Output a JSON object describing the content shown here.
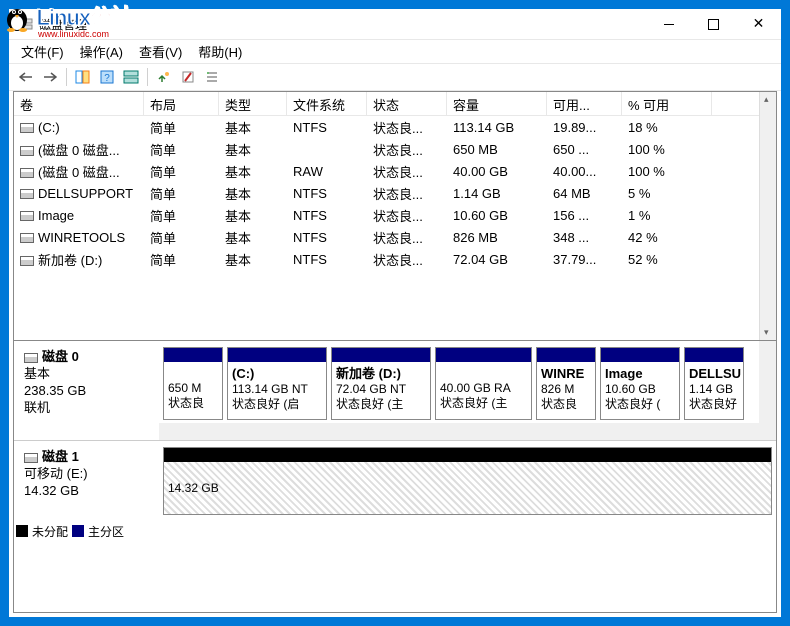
{
  "watermark": {
    "brand1": "Linux",
    "brand2": "公社",
    "url": "www.linuxidc.com"
  },
  "window": {
    "title": "磁盘管理"
  },
  "menubar": [
    "文件(F)",
    "操作(A)",
    "查看(V)",
    "帮助(H)"
  ],
  "columns": {
    "volume": "卷",
    "layout": "布局",
    "type": "类型",
    "fs": "文件系统",
    "status": "状态",
    "capacity": "容量",
    "free": "可用...",
    "pct": "% 可用"
  },
  "volumes": [
    {
      "name": "(C:)",
      "layout": "简单",
      "type": "基本",
      "fs": "NTFS",
      "status": "状态良...",
      "cap": "113.14 GB",
      "free": "19.89...",
      "pct": "18 %"
    },
    {
      "name": "(磁盘 0 磁盘...",
      "layout": "简单",
      "type": "基本",
      "fs": "",
      "status": "状态良...",
      "cap": "650 MB",
      "free": "650 ...",
      "pct": "100 %"
    },
    {
      "name": "(磁盘 0 磁盘...",
      "layout": "简单",
      "type": "基本",
      "fs": "RAW",
      "status": "状态良...",
      "cap": "40.00 GB",
      "free": "40.00...",
      "pct": "100 %"
    },
    {
      "name": "DELLSUPPORT",
      "layout": "简单",
      "type": "基本",
      "fs": "NTFS",
      "status": "状态良...",
      "cap": "1.14 GB",
      "free": "64 MB",
      "pct": "5 %"
    },
    {
      "name": "Image",
      "layout": "简单",
      "type": "基本",
      "fs": "NTFS",
      "status": "状态良...",
      "cap": "10.60 GB",
      "free": "156 ...",
      "pct": "1 %"
    },
    {
      "name": "WINRETOOLS",
      "layout": "简单",
      "type": "基本",
      "fs": "NTFS",
      "status": "状态良...",
      "cap": "826 MB",
      "free": "348 ...",
      "pct": "42 %"
    },
    {
      "name": "新加卷 (D:)",
      "layout": "简单",
      "type": "基本",
      "fs": "NTFS",
      "status": "状态良...",
      "cap": "72.04 GB",
      "free": "37.79...",
      "pct": "52 %"
    }
  ],
  "disks": {
    "d0": {
      "title": "磁盘 0",
      "type": "基本",
      "size": "238.35 GB",
      "status": "联机",
      "parts": [
        {
          "label": "",
          "size": "650 M",
          "stat": "状态良"
        },
        {
          "label": "(C:)",
          "size": "113.14 GB NT",
          "stat": "状态良好 (启"
        },
        {
          "label": "新加卷  (D:)",
          "size": "72.04 GB NT",
          "stat": "状态良好 (主"
        },
        {
          "label": "",
          "size": "40.00 GB RA",
          "stat": "状态良好 (主"
        },
        {
          "label": "WINRE",
          "size": "826 M",
          "stat": "状态良"
        },
        {
          "label": "Image",
          "size": "10.60 GB",
          "stat": "状态良好 ("
        },
        {
          "label": "DELLSU",
          "size": "1.14 GB",
          "stat": "状态良好"
        }
      ]
    },
    "d1": {
      "title": "磁盘 1",
      "type": "可移动 (E:)",
      "size": "14.32 GB",
      "part_size": "14.32 GB"
    }
  },
  "legend": {
    "unalloc": "未分配",
    "primary": "主分区"
  }
}
